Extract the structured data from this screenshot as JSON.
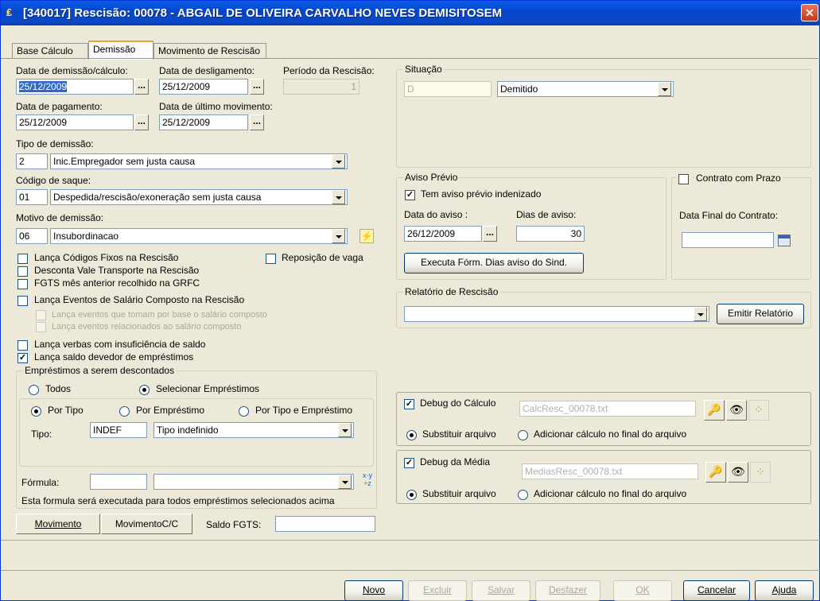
{
  "window": {
    "title": "[340017] Rescisão: 00078 - ABGAIL DE OLIVEIRA CARVALHO NEVES DEMISITOSEM",
    "close_label": "✕"
  },
  "tabs": [
    "Base Cálculo",
    "Demissão",
    "Movimento de Rescisão"
  ],
  "left": {
    "data_demissao_label": "Data de demissão/cálculo:",
    "data_demissao_value": "25/12/2009",
    "data_desligamento_label": "Data de desligamento:",
    "data_desligamento_value": "25/12/2009",
    "periodo_label": "Período da Rescisão:",
    "periodo_value": "1",
    "data_pagamento_label": "Data de pagamento:",
    "data_pagamento_value": "25/12/2009",
    "data_ultimo_mov_label": "Data de último movimento:",
    "data_ultimo_mov_value": "25/12/2009",
    "tipo_demissao_label": "Tipo de demissão:",
    "tipo_demissao_code": "2",
    "tipo_demissao_value": "Inic.Empregador sem justa causa",
    "codigo_saque_label": "Código de saque:",
    "codigo_saque_code": "01",
    "codigo_saque_value": "Despedida/rescisão/exoneração sem justa causa",
    "motivo_label": "Motivo de demissão:",
    "motivo_code": "06",
    "motivo_value": "Insubordinacao",
    "dots": "...",
    "checks": {
      "lanca_codigos": "Lança Códigos Fixos na Rescisão",
      "reposicao": "Reposição de vaga",
      "desconta_vale": "Desconta Vale Transporte na Rescisão",
      "fgts_mes": "FGTS mês anterior recolhido na GRFC",
      "lanca_eventos": "Lança Eventos de Salário Composto na Rescisão",
      "lanca_base": "Lança eventos que tomam por base o salário composto",
      "lanca_relacionados": "Lança eventos relacionados ao salário composto",
      "lanca_verbas": "Lança verbas com insuficiência de saldo",
      "lanca_saldo": "Lança saldo devedor de empréstimos"
    },
    "emprestimos": {
      "title": "Empréstimos a serem descontados",
      "todos": "Todos",
      "selecionar": "Selecionar Empréstimos",
      "por_tipo": "Por Tipo",
      "por_emprestimo": "Por Empréstimo",
      "por_tipo_emprestimo": "Por Tipo e Empréstimo",
      "tipo_label": "Tipo:",
      "tipo_code": "INDEF",
      "tipo_value": "Tipo indefinido",
      "formula_label": "Fórmula:",
      "formula_code": "",
      "formula_value": "",
      "formula_note": "Esta formula será executada para todos empréstimos selecionados acima"
    },
    "movimento_btn": "Movimento",
    "movimento_cc_btn": "MovimentoC/C",
    "saldo_fgts_label": "Saldo FGTS:",
    "saldo_fgts_value": ""
  },
  "right": {
    "situacao_title": "Situação",
    "situacao_code": "D",
    "situacao_value": "Demitido",
    "aviso_title": "Aviso Prévio",
    "aviso_check": "Tem aviso prévio indenizado",
    "data_aviso_label": "Data do aviso :",
    "data_aviso_value": "26/12/2009",
    "dias_aviso_label": "Dias de aviso:",
    "dias_aviso_value": "30",
    "executa_btn": "Executa Fórm. Dias aviso do Sind.",
    "contrato_title": "Contrato com Prazo",
    "data_final_label": "Data Final do Contrato:",
    "data_final_value": "",
    "relatorio_title": "Relatório de Rescisão",
    "relatorio_value": "",
    "emitir_btn": "Emitir Relatório",
    "debug_calculo_label": "Debug do Cálculo",
    "debug_calculo_file": "CalcResc_00078.txt",
    "debug_media_label": "Debug da Média",
    "debug_media_file": "MediasResc_00078.txt",
    "substituir": "Substituir arquivo",
    "adicionar": "Adicionar cálculo no final do arquivo"
  },
  "footer": {
    "novo": "Novo",
    "excluir": "Excluir",
    "salvar": "Salvar",
    "desfazer": "Desfazer",
    "ok": "OK",
    "cancelar": "Cancelar",
    "ajuda": "Ajuda"
  }
}
